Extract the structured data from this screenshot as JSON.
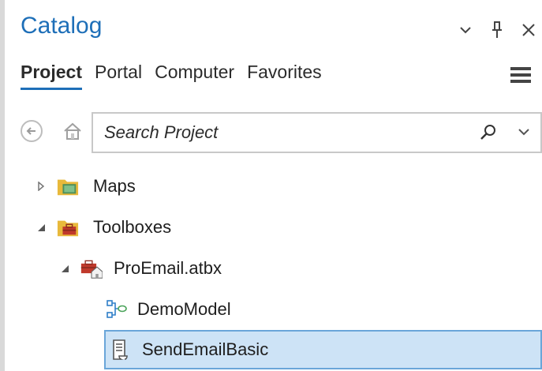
{
  "pane": {
    "title": "Catalog"
  },
  "tabs": [
    {
      "label": "Project",
      "active": true
    },
    {
      "label": "Portal",
      "active": false
    },
    {
      "label": "Computer",
      "active": false
    },
    {
      "label": "Favorites",
      "active": false
    }
  ],
  "search": {
    "placeholder": "Search Project"
  },
  "tree": {
    "maps": {
      "label": "Maps",
      "icon": "folder-map-icon"
    },
    "toolboxes": {
      "label": "Toolboxes",
      "icon": "folder-toolbox-icon"
    },
    "toolbox_file": {
      "label": "ProEmail.atbx",
      "icon": "toolbox-home-icon"
    },
    "model_tool": {
      "label": "DemoModel",
      "icon": "model-icon"
    },
    "script_tool": {
      "label": "SendEmailBasic",
      "icon": "script-icon",
      "selected": true
    }
  },
  "colors": {
    "accent": "#1e6fb8",
    "selection_bg": "#cde3f6",
    "selection_border": "#6aa6d9",
    "folder_yellow": "#e8b93b"
  }
}
